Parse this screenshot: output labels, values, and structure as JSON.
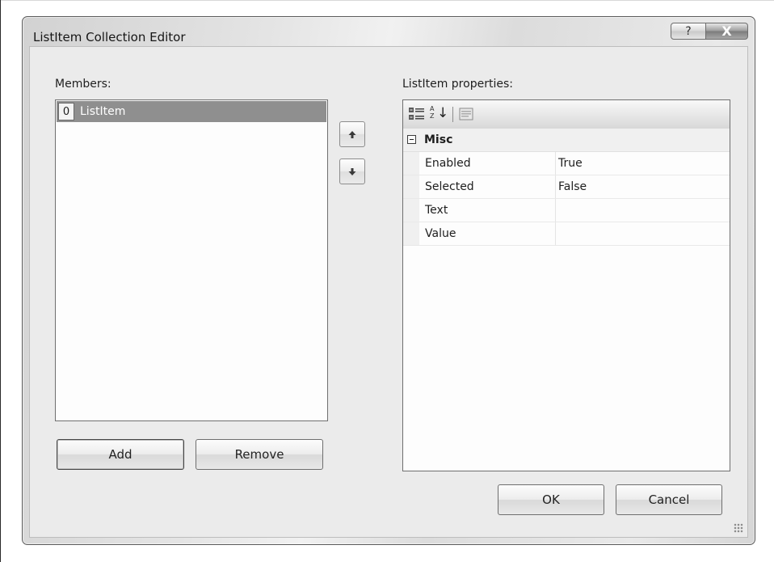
{
  "window": {
    "title": "ListItem Collection Editor",
    "help_label": "?",
    "close_label": "X"
  },
  "members": {
    "label": "Members:",
    "items": [
      {
        "index": "0",
        "text": "ListItem",
        "selected": true
      }
    ],
    "move_up_icon": "arrow-up-icon",
    "move_down_icon": "arrow-down-icon",
    "add_label": "Add",
    "remove_label": "Remove"
  },
  "properties": {
    "label": "ListItem properties:",
    "toolbar": {
      "categorized_icon": "categorized-icon",
      "alphabetical_icon": "alphabetical-icon",
      "property_pages_icon": "property-pages-icon",
      "az_top": "A",
      "az_bottom": "Z",
      "arrow": "↓"
    },
    "category": "Misc",
    "rows": [
      {
        "name": "Enabled",
        "value": "True"
      },
      {
        "name": "Selected",
        "value": "False"
      },
      {
        "name": "Text",
        "value": ""
      },
      {
        "name": "Value",
        "value": ""
      }
    ]
  },
  "footer": {
    "ok_label": "OK",
    "cancel_label": "Cancel"
  },
  "colors": {
    "selection": "#8f8f8f",
    "dialog_background": "#ebebeb",
    "close_button": "#8a8a8a"
  }
}
